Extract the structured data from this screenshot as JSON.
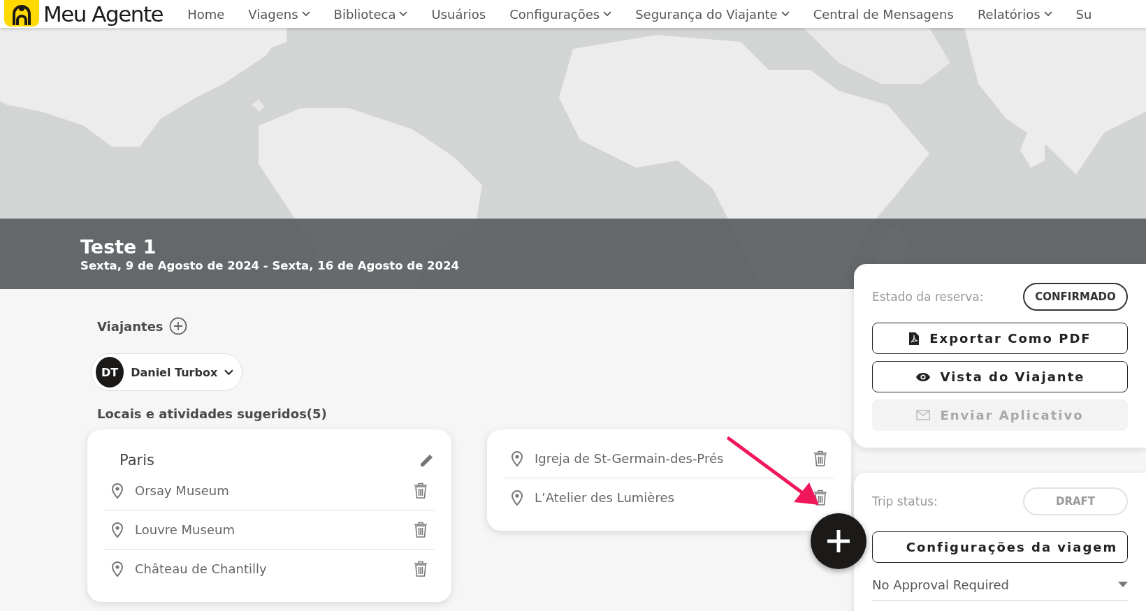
{
  "brand": {
    "name": "Meu Agente"
  },
  "nav": [
    {
      "label": "Home",
      "dropdown": false
    },
    {
      "label": "Viagens",
      "dropdown": true
    },
    {
      "label": "Biblioteca",
      "dropdown": true
    },
    {
      "label": "Usuários",
      "dropdown": false
    },
    {
      "label": "Configurações",
      "dropdown": true
    },
    {
      "label": "Segurança do Viajante",
      "dropdown": true
    },
    {
      "label": "Central de Mensagens",
      "dropdown": false
    },
    {
      "label": "Relatórios",
      "dropdown": true
    },
    {
      "label": "Su",
      "dropdown": false
    }
  ],
  "trip": {
    "title": "Teste 1",
    "dates": "Sexta, 9 de Agosto de 2024 - Sexta, 16 de Agosto de 2024"
  },
  "travelers": {
    "heading": "Viajantes",
    "people": [
      {
        "initials": "DT",
        "name": "Daniel Turbox"
      }
    ]
  },
  "suggestions": {
    "heading": "Locais e atividades sugeridos(5)",
    "cards": [
      {
        "city": "Paris",
        "places": [
          "Orsay Museum",
          "Louvre Museum",
          "Château de Chantilly"
        ]
      },
      {
        "places": [
          "Igreja de St-Germain-des-Prés",
          "L’Atelier des Lumières"
        ]
      }
    ]
  },
  "booking": {
    "label": "Estado da reserva:",
    "status": "CONFIRMADO",
    "actions": [
      {
        "label": "Exportar Como PDF",
        "disabled": false
      },
      {
        "label": "Vista do Viajante",
        "disabled": false
      },
      {
        "label": "Enviar Aplicativo",
        "disabled": true
      }
    ]
  },
  "trip_status": {
    "label": "Trip status:",
    "status": "DRAFT",
    "settings_button": "Configurações da viagem",
    "approval": {
      "value": "No Approval Required"
    }
  }
}
